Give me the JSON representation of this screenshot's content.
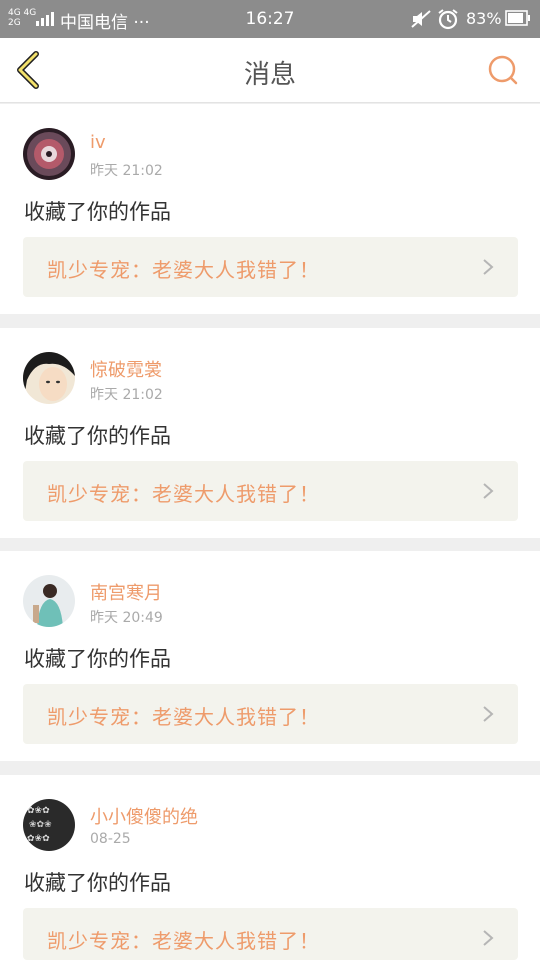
{
  "status_bar": {
    "network_label": "4G 4G\n2G",
    "carrier": "中国电信 ···",
    "time": "16:27",
    "battery_percent": "83%"
  },
  "nav": {
    "title": "消息",
    "back_icon": "chevron-left-icon",
    "search_icon": "search-icon",
    "accent_color": "#ee9b6b"
  },
  "messages": [
    {
      "username": "iv",
      "time": "昨天 21:02",
      "action": "收藏了你的作品",
      "work_title": "凯少专宠：老婆大人我错了！"
    },
    {
      "username": "惊破霓裳",
      "time": "昨天 21:02",
      "action": "收藏了你的作品",
      "work_title": "凯少专宠：老婆大人我错了！"
    },
    {
      "username": "南宫寒月",
      "time": "昨天 20:49",
      "action": "收藏了你的作品",
      "work_title": "凯少专宠：老婆大人我错了！"
    },
    {
      "username": "小小傻傻的绝",
      "time": "08-25",
      "action": "收藏了你的作品",
      "work_title": "凯少专宠：老婆大人我错了！"
    }
  ]
}
